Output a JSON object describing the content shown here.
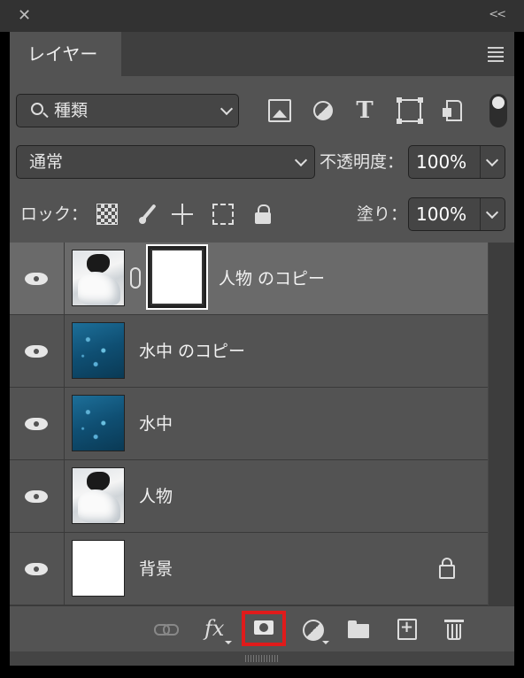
{
  "window": {
    "close_icon": "close-icon",
    "collapse_label": "<<"
  },
  "panel": {
    "tab_label": "レイヤー",
    "menu_icon": "hamburger-menu-icon"
  },
  "filter": {
    "kind_label": "種類",
    "icons": [
      "image-filter-icon",
      "adjustment-filter-icon",
      "type-filter-icon",
      "shape-filter-icon",
      "smart-object-filter-icon"
    ],
    "toggle_on": true
  },
  "blend": {
    "mode": "通常",
    "opacity_label": "不透明度：",
    "opacity_value": "100%"
  },
  "lock": {
    "label": "ロック：",
    "icons": [
      "lock-pixels-icon",
      "lock-image-pixels-icon",
      "lock-position-icon",
      "lock-artboard-icon",
      "lock-all-icon"
    ],
    "fill_label": "塗り：",
    "fill_value": "100%"
  },
  "layers": [
    {
      "name": "人物 のコピー",
      "visible": true,
      "selected": true,
      "thumb": "person",
      "has_mask": true,
      "locked": false
    },
    {
      "name": "水中 のコピー",
      "visible": true,
      "selected": false,
      "thumb": "water",
      "has_mask": false,
      "locked": false
    },
    {
      "name": "水中",
      "visible": true,
      "selected": false,
      "thumb": "water",
      "has_mask": false,
      "locked": false
    },
    {
      "name": "人物",
      "visible": true,
      "selected": false,
      "thumb": "person",
      "has_mask": false,
      "locked": false
    },
    {
      "name": "背景",
      "visible": true,
      "selected": false,
      "thumb": "white",
      "has_mask": false,
      "locked": true
    }
  ],
  "footer": {
    "fx_label": "fx",
    "highlight_color": "#e01b1b",
    "buttons": [
      "link-layers-icon",
      "fx-icon",
      "add-mask-icon",
      "adjustment-layer-icon",
      "group-folder-icon",
      "new-layer-icon",
      "trash-icon"
    ]
  },
  "colors": {
    "panel_bg": "#535353",
    "selected_row": "#6a6a6a",
    "text": "#e6e6e6"
  }
}
